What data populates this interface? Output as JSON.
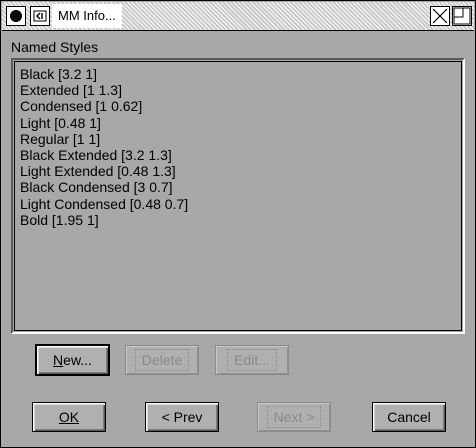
{
  "window": {
    "title": "MM Info..."
  },
  "group": {
    "label": "Named Styles"
  },
  "styles": [
    "Black [3.2 1]",
    "Extended [1 1.3]",
    "Condensed [1 0.62]",
    "Light [0.48 1]",
    "Regular [1 1]",
    "Black Extended [3.2 1.3]",
    "Light Extended [0.48 1.3]",
    "Black Condensed [3 0.7]",
    "Light Condensed [0.48 0.7]",
    "Bold [1.95 1]"
  ],
  "list_buttons": {
    "new_mnemonic": "N",
    "new_rest": "ew...",
    "delete": "Delete",
    "edit": "Edit..."
  },
  "nav_buttons": {
    "ok": "OK",
    "prev": "< Prev",
    "next": "Next >",
    "cancel": "Cancel"
  }
}
